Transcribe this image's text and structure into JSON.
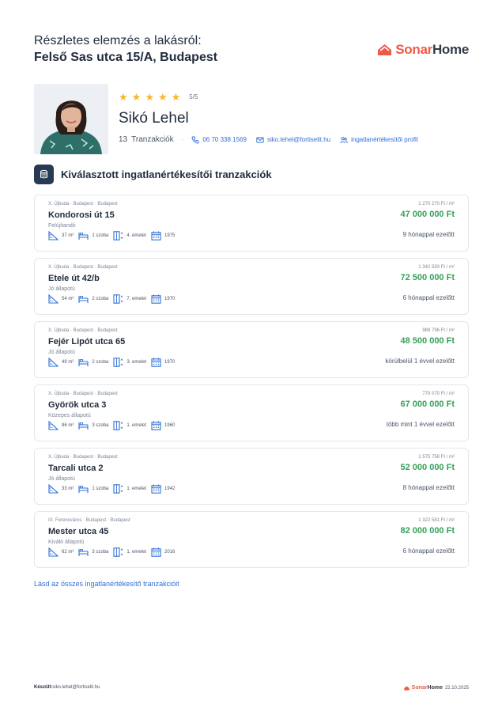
{
  "header": {
    "line1": "Részletes elemzés a lakásról:",
    "line2": "Felső Sas utca 15/A, Budapest",
    "logo_part1": "Sonar",
    "logo_part2": "Home"
  },
  "agent": {
    "rating": "5/5",
    "stars": 5,
    "name": "Sikó Lehel",
    "transactions_count": "13",
    "transactions_label": "Tranzakciók",
    "phone": "06 70 338 1569",
    "email": "siko.lehel@fortiselit.hu",
    "profile_link": "ingatlanértékesítői profil"
  },
  "section": {
    "title": "Kiválasztott ingatlanértékesítői tranzakciók"
  },
  "transactions": [
    {
      "crumb": "X. Újbuda · Budapest · Budapest",
      "street": "Kondorosi út 15",
      "condition": "Felújítandó",
      "area": "37 m²",
      "rooms": "1 szoba",
      "floor": "4. emelet",
      "year": "1975",
      "price_per_sqm": "1 270 270 Ft / m²",
      "price": "47 000 000 Ft",
      "ago": "9 hónappal ezelőtt"
    },
    {
      "crumb": "X. Újbuda · Budapest · Budapest",
      "street": "Etele út 42/b",
      "condition": "Jó állapotú",
      "area": "54 m²",
      "rooms": "2 szoba",
      "floor": "7. emelet",
      "year": "1970",
      "price_per_sqm": "1 342 593 Ft / m²",
      "price": "72 500 000 Ft",
      "ago": "6 hónappal ezelőtt"
    },
    {
      "crumb": "X. Újbuda · Budapest · Budapest",
      "street": "Fejér Lipót utca 65",
      "condition": "Jó állapotú",
      "area": "49 m²",
      "rooms": "2 szoba",
      "floor": "3. emelet",
      "year": "1970",
      "price_per_sqm": "989 796 Ft / m²",
      "price": "48 500 000 Ft",
      "ago": "körülbelül 1 évvel ezelőtt"
    },
    {
      "crumb": "X. Újbuda · Budapest · Budapest",
      "street": "Györök utca 3",
      "condition": "Közepes állapotú",
      "area": "86 m²",
      "rooms": "3 szoba",
      "floor": "1. emelet",
      "year": "1960",
      "price_per_sqm": "779 070 Ft / m²",
      "price": "67 000 000 Ft",
      "ago": "több mint 1 évvel ezelőtt"
    },
    {
      "crumb": "X. Újbuda · Budapest · Budapest",
      "street": "Tarcali utca 2",
      "condition": "Jó állapotú",
      "area": "33 m²",
      "rooms": "1 szoba",
      "floor": "1. emelet",
      "year": "1942",
      "price_per_sqm": "1 575 758 Ft / m²",
      "price": "52 000 000 Ft",
      "ago": "8 hónappal ezelőtt"
    },
    {
      "crumb": "IX. Ferencváros · Budapest · Budapest",
      "street": "Mester utca 45",
      "condition": "Kiváló állapotú",
      "area": "62 m²",
      "rooms": "3 szoba",
      "floor": "1. emelet",
      "year": "2016",
      "price_per_sqm": "1 322 581 Ft / m²",
      "price": "82 000 000 Ft",
      "ago": "6 hónappal ezelőtt"
    }
  ],
  "all_link": "Lásd az összes ingatlanértékesítő tranzakcióit",
  "footer": {
    "made_label": "Készült:",
    "made_email": "siko.lehel@fortiselit.hu",
    "logo_part1": "Sonar",
    "logo_part2": "Home",
    "date": "22.10.2025"
  },
  "colors": {
    "accent_blue": "#2f6fd6",
    "price_green": "#35a158",
    "brand_red": "#ef5a48",
    "star": "#f5b82e",
    "dark_badge": "#263a53"
  }
}
